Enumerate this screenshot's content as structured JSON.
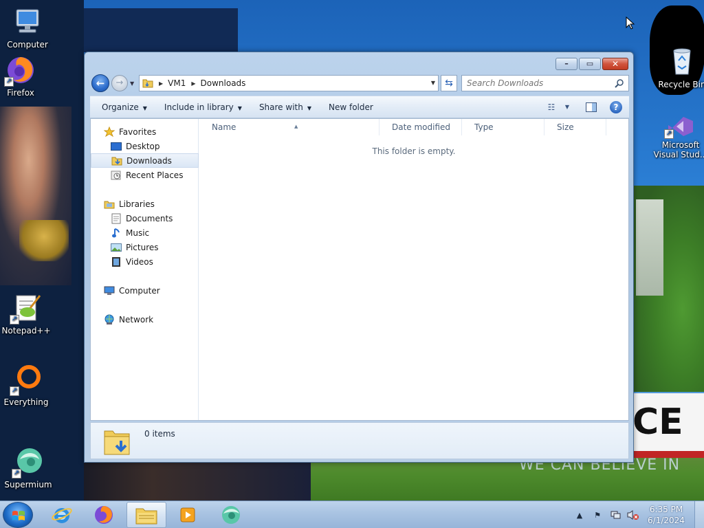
{
  "desktop": {
    "icons": [
      {
        "label": "Computer"
      },
      {
        "label": "Firefox"
      },
      {
        "label": "Notepad++"
      },
      {
        "label": "Everything"
      },
      {
        "label": "Supermium"
      },
      {
        "label": "Recycle Bin"
      },
      {
        "label": "Microsoft Visual Stud..."
      }
    ],
    "background_text": {
      "banner": "CE",
      "slogan": "WE CAN BELIEVE IN"
    }
  },
  "window": {
    "nav": {
      "back": "back-arrow-icon",
      "forward": "forward-arrow-icon"
    },
    "address": {
      "crumbs": [
        "VM1",
        "Downloads"
      ]
    },
    "search": {
      "placeholder": "Search Downloads"
    },
    "toolbar": {
      "organize": "Organize",
      "include_in_library": "Include in library",
      "share_with": "Share with",
      "new_folder": "New folder"
    },
    "navpane": {
      "favorites": "Favorites",
      "desktop": "Desktop",
      "downloads": "Downloads",
      "recent_places": "Recent Places",
      "libraries": "Libraries",
      "documents": "Documents",
      "music": "Music",
      "pictures": "Pictures",
      "videos": "Videos",
      "computer": "Computer",
      "network": "Network"
    },
    "columns": {
      "name": "Name",
      "date_modified": "Date modified",
      "type": "Type",
      "size": "Size"
    },
    "empty_message": "This folder is empty.",
    "details": {
      "item_count": "0 items"
    }
  },
  "taskbar": {
    "clock": {
      "time": "6:35 PM",
      "date": "6/1/2024"
    }
  },
  "colors": {
    "accent": "#2c6ccc",
    "selection": "#dbe7f6",
    "desktop": "#2a7dd3"
  }
}
